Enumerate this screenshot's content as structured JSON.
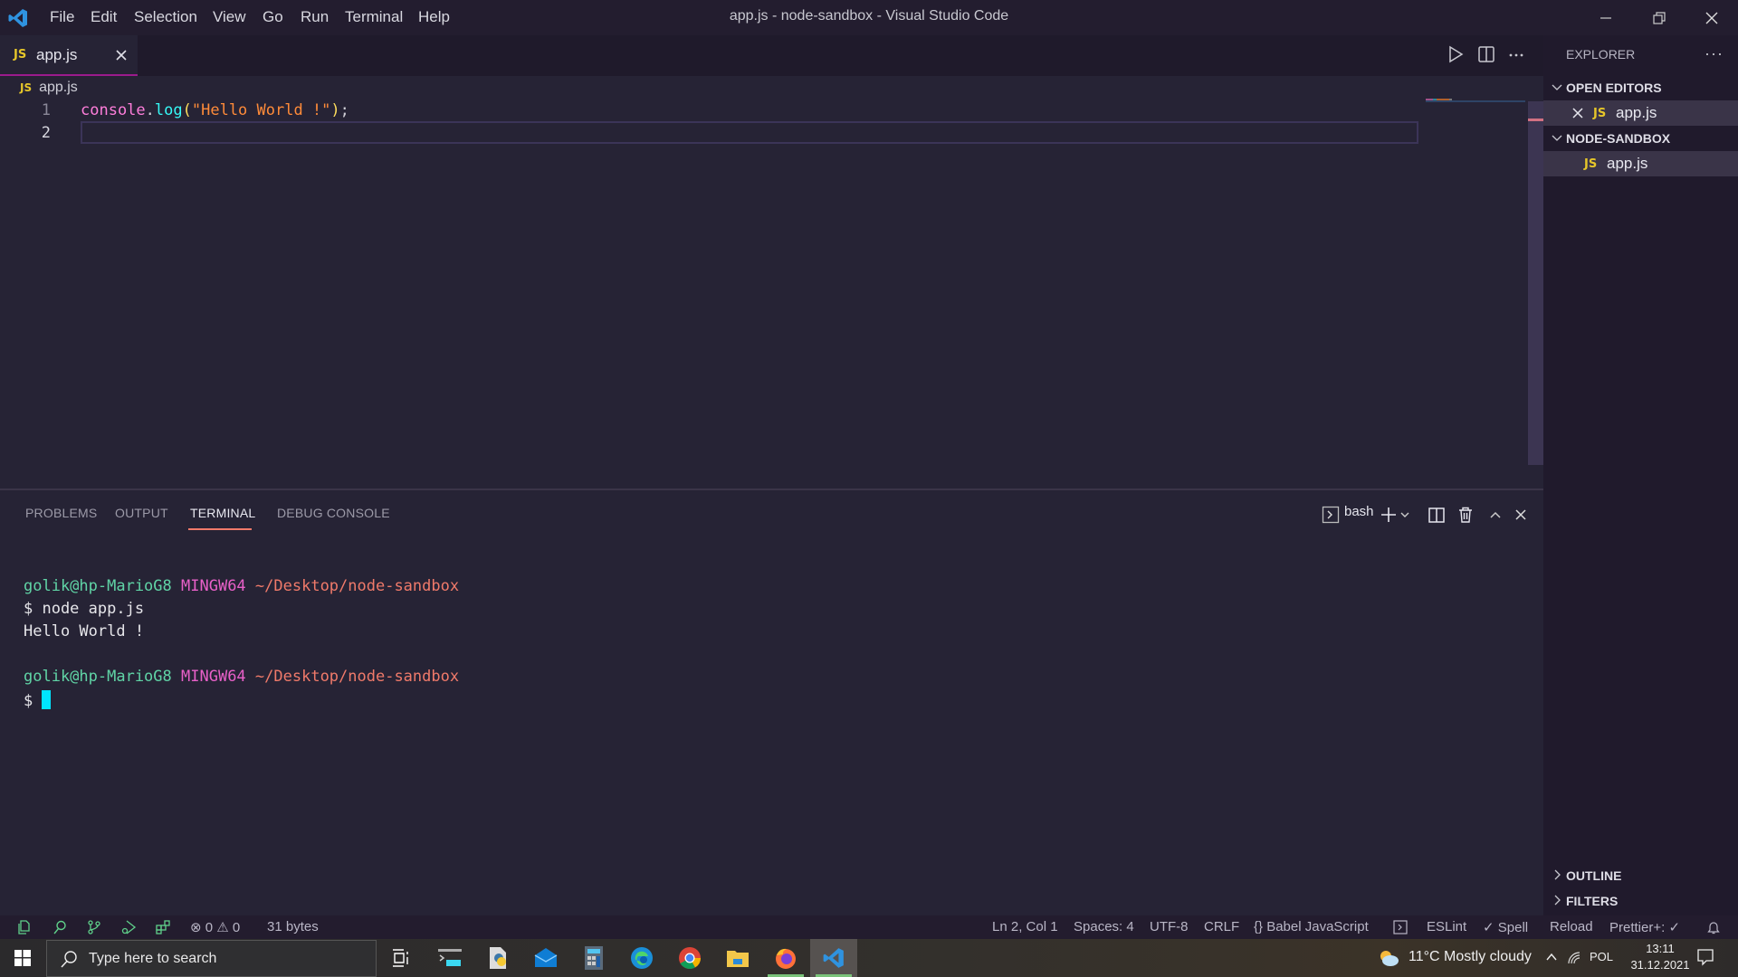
{
  "window": {
    "title": "app.js - node-sandbox - Visual Studio Code",
    "menu": [
      "File",
      "Edit",
      "Selection",
      "View",
      "Go",
      "Run",
      "Terminal",
      "Help"
    ]
  },
  "tabs": [
    {
      "label": "app.js",
      "badge": "JS",
      "active": true
    }
  ],
  "breadcrumb": {
    "badge": "JS",
    "file": "app.js"
  },
  "editor": {
    "lines": [
      {
        "number": "1",
        "tokens": [
          {
            "text": "console",
            "type": "ident"
          },
          {
            "text": ".",
            "type": "punct"
          },
          {
            "text": "log",
            "type": "fn"
          },
          {
            "text": "(",
            "type": "paren"
          },
          {
            "text": "\"Hello World !\"",
            "type": "str"
          },
          {
            "text": ")",
            "type": "paren"
          },
          {
            "text": ";",
            "type": "punct"
          }
        ]
      },
      {
        "number": "2",
        "tokens": []
      }
    ],
    "active_line": 2
  },
  "panel": {
    "tabs": [
      "PROBLEMS",
      "OUTPUT",
      "TERMINAL",
      "DEBUG CONSOLE"
    ],
    "active_tab": "TERMINAL",
    "shell": "bash",
    "terminal": {
      "prompt1": {
        "user": "golik@hp-MarioG8",
        "host": "MINGW64",
        "path": "~/Desktop/node-sandbox"
      },
      "command": "$ node app.js",
      "output": "Hello World !",
      "prompt2": {
        "user": "golik@hp-MarioG8",
        "host": "MINGW64",
        "path": "~/Desktop/node-sandbox"
      },
      "input_prefix": "$ "
    }
  },
  "sidebar": {
    "title": "EXPLORER",
    "sections": {
      "open_editors": {
        "label": "OPEN EDITORS",
        "items": [
          {
            "badge": "JS",
            "label": "app.js"
          }
        ]
      },
      "workspace": {
        "label": "NODE-SANDBOX",
        "items": [
          {
            "badge": "JS",
            "label": "app.js"
          }
        ]
      },
      "outline": {
        "label": "OUTLINE"
      },
      "filters": {
        "label": "FILTERS"
      }
    }
  },
  "statusbar": {
    "errors": "0",
    "warnings": "0",
    "file_size": "31 bytes",
    "position": "Ln 2, Col 1",
    "indent": "Spaces: 4",
    "encoding": "UTF-8",
    "eol": "CRLF",
    "language": "Babel JavaScript",
    "eslint": "ESLint",
    "spell": "Spell",
    "reload": "Reload",
    "prettier": "Prettier+:"
  },
  "taskbar": {
    "search_placeholder": "Type here to search",
    "weather": "11°C  Mostly cloudy",
    "language": "POL",
    "time": "13:11",
    "date": "31.12.2021"
  },
  "colors": {
    "accent_tab_border": "#9b1b8c",
    "terminal_tab_underline": "#f07a6a",
    "js_badge": "#e6c62a",
    "cursor": "#00e5ff"
  }
}
